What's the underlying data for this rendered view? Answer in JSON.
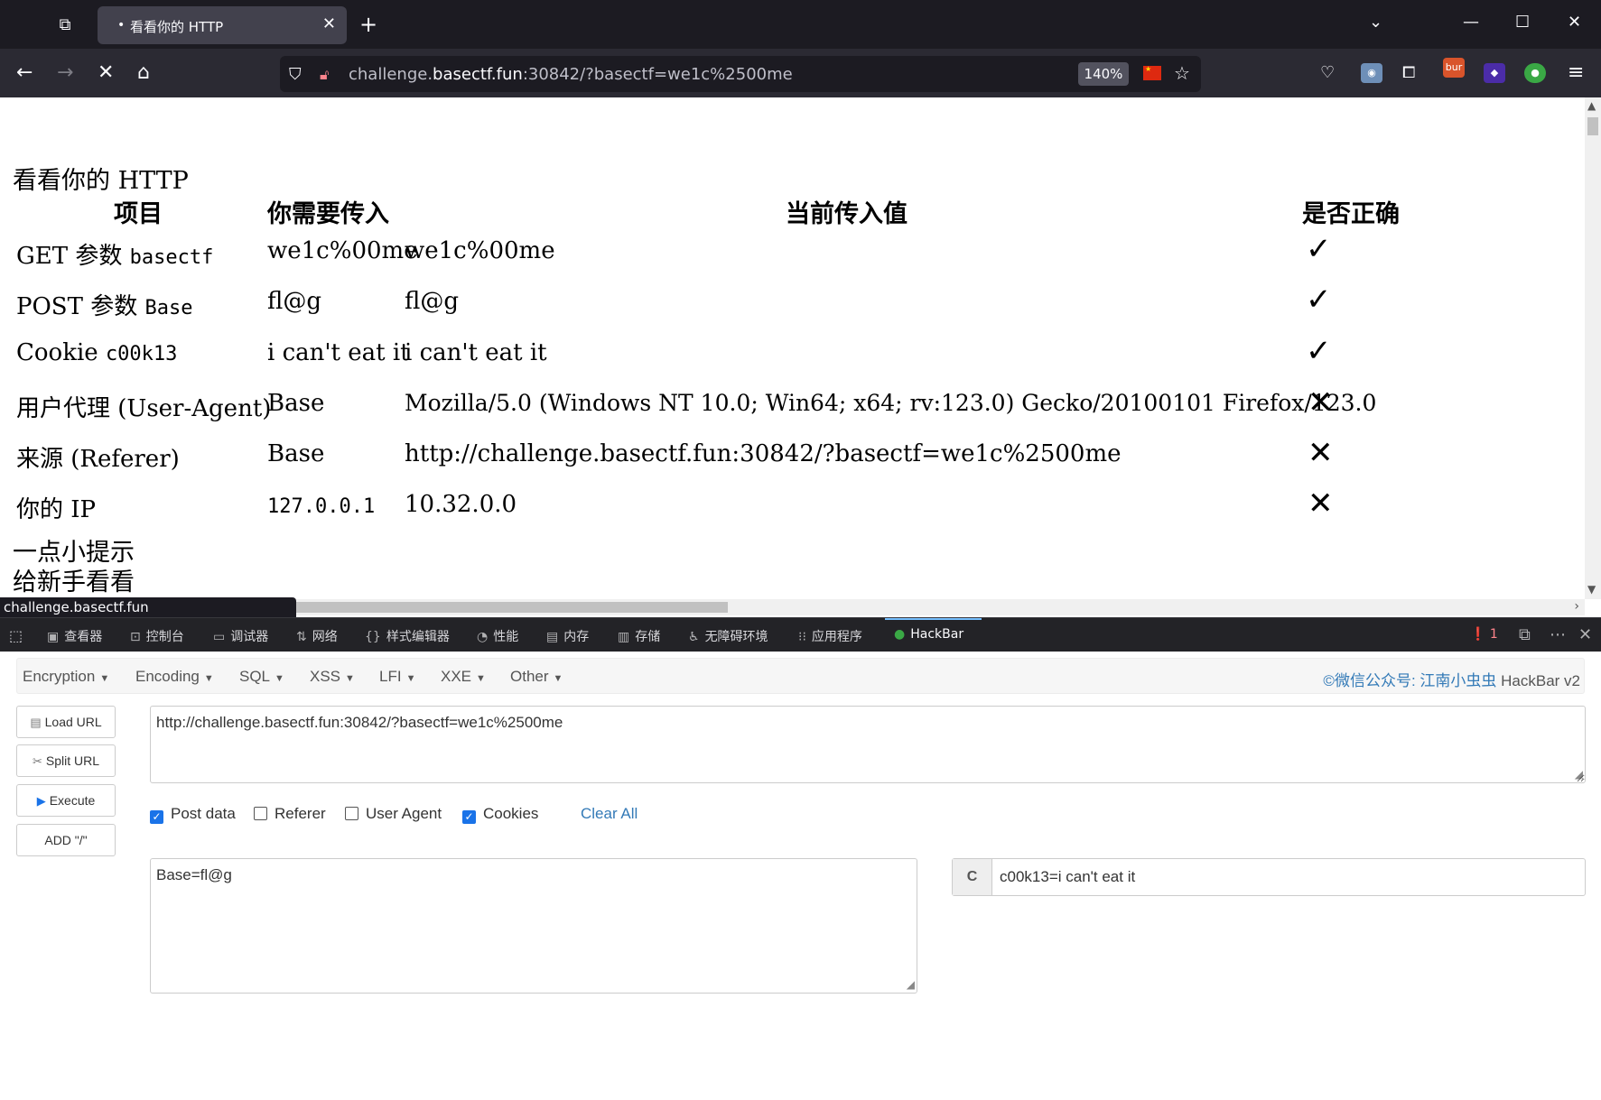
{
  "browser": {
    "tab_title": "看看你的 HTTP",
    "tab_dot": "•",
    "url_host_prefix": "challenge.",
    "url_host": "basectf.fun",
    "url_rest": ":30842/?basectf=we1c%2500me",
    "zoom": "140%"
  },
  "page": {
    "heading": "看看你的 HTTP",
    "headers": [
      "项目",
      "你需要传入",
      "当前传入值",
      "是否正确"
    ],
    "rows": [
      {
        "item": "GET 参数",
        "param": "basectf",
        "need": "we1c%00me",
        "current": "we1c%00me",
        "ok": "✓"
      },
      {
        "item": "POST 参数",
        "param": "Base",
        "need": "fl@g",
        "current": "fl@g",
        "ok": "✓"
      },
      {
        "item": "Cookie",
        "param": "c00k13",
        "need": "i can't eat it",
        "current": "i can't eat it",
        "ok": "✓"
      },
      {
        "item": "用户代理 (User-Agent)",
        "param": "",
        "need": "Base",
        "current": "Mozilla/5.0 (Windows NT 10.0; Win64; x64; rv:123.0) Gecko/20100101 Firefox/123.0",
        "ok": "✕"
      },
      {
        "item": "来源 (Referer)",
        "param": "",
        "need": "Base",
        "current": "http://challenge.basectf.fun:30842/?basectf=we1c%2500me",
        "ok": "✕"
      },
      {
        "item": "你的 IP",
        "param": "",
        "need": "127.0.0.1",
        "current": "10.32.0.0",
        "ok": "✕"
      }
    ],
    "hint_1": "一点小提示",
    "hint_2": "给新手看看",
    "status_url": "challenge.basectf.fun"
  },
  "devtools": {
    "tabs": [
      "查看器",
      "控制台",
      "调试器",
      "网络",
      "样式编辑器",
      "性能",
      "内存",
      "存储",
      "无障碍环境",
      "应用程序",
      "HackBar"
    ],
    "error_count": "1"
  },
  "hackbar": {
    "menu": [
      "Encryption",
      "Encoding",
      "SQL",
      "XSS",
      "LFI",
      "XXE",
      "Other"
    ],
    "brand_link": "©微信公众号: 江南小虫虫",
    "brand_name": " HackBar v2",
    "buttons": [
      "Load URL",
      "Split URL",
      "Execute",
      "ADD \"/\""
    ],
    "url_value": "http://challenge.basectf.fun:30842/?basectf=we1c%2500me",
    "options": [
      {
        "label": "Post data",
        "checked": true
      },
      {
        "label": "Referer",
        "checked": false
      },
      {
        "label": "User Agent",
        "checked": false
      },
      {
        "label": "Cookies",
        "checked": true
      }
    ],
    "clear_all": "Clear All",
    "post_value": "Base=fl@g",
    "cookie_label": "C",
    "cookie_value": "c00k13=i can't eat it"
  },
  "colors": {
    "accent": "#1a73e8",
    "link": "#337ab7",
    "devtools_active": "#75bfff"
  }
}
